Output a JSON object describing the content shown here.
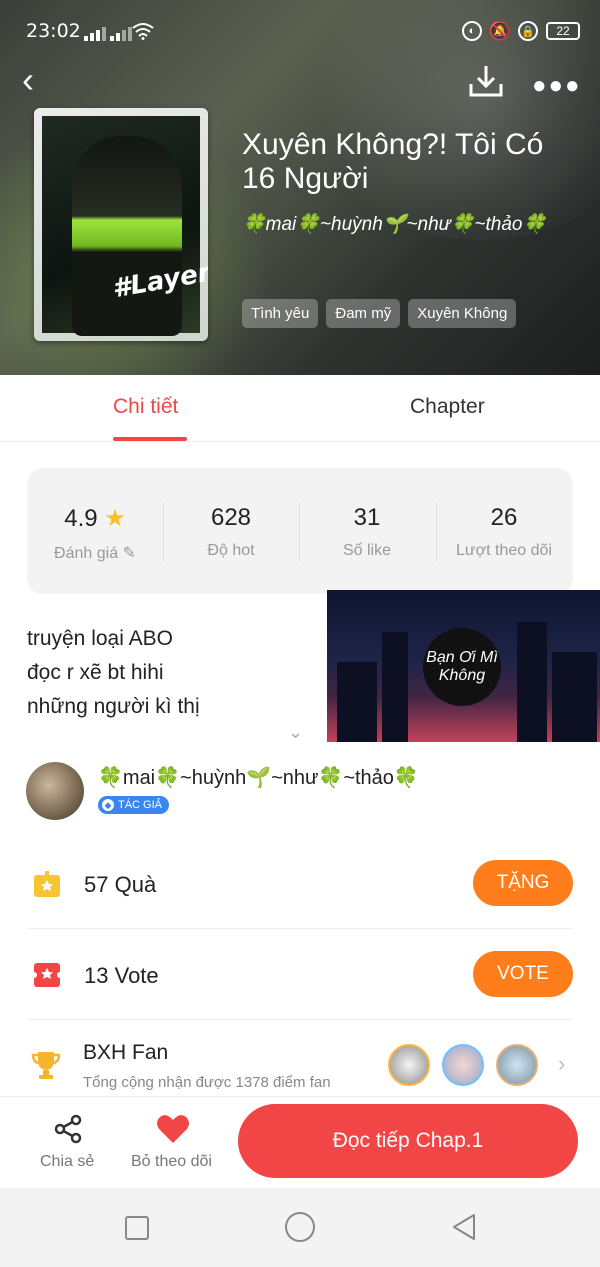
{
  "status_bar": {
    "time": "23:02",
    "battery": "22"
  },
  "story": {
    "title": "Xuyên Không?! Tôi Có 16 Người",
    "author": "🍀mai🍀~huỳnh🌱~như🍀~thảo🍀",
    "cover_text": "#Layer",
    "tags": [
      "Tình yêu",
      "Đam mỹ",
      "Xuyên Không"
    ]
  },
  "tabs": [
    {
      "label": "Chi tiết",
      "active": true
    },
    {
      "label": "Chapter",
      "active": false
    }
  ],
  "stats": [
    {
      "value": "4.9",
      "label": "Đánh giá"
    },
    {
      "value": "628",
      "label": "Độ hot"
    },
    {
      "value": "31",
      "label": "Số like"
    },
    {
      "value": "26",
      "label": "Lượt theo dõi"
    }
  ],
  "description": [
    "truyện loại ABO",
    "đọc r xẽ bt hihi",
    "những người kì thị"
  ],
  "media_card": {
    "title": "Bạn Ơi Mì Không"
  },
  "author_row": {
    "name": "🍀mai🍀~huỳnh🌱~như🍀~thảo🍀",
    "badge": "TÁC GIẢ"
  },
  "gifts": {
    "count": "57",
    "label": "Quà",
    "button": "TẶNG"
  },
  "votes": {
    "count": "13",
    "label": "Vote",
    "button": "VOTE"
  },
  "fan_rank": {
    "title": "BXH Fan",
    "subtitle": "Tổng cộng nhận được 1378 điểm fan"
  },
  "bottom_bar": {
    "share": "Chia sẻ",
    "unfollow": "Bỏ theo dõi",
    "read": "Đọc tiếp Chap.1"
  },
  "colors": {
    "accent_red": "#f24545",
    "accent_orange": "#ff7d1a",
    "badge_blue": "#3a86f0"
  }
}
